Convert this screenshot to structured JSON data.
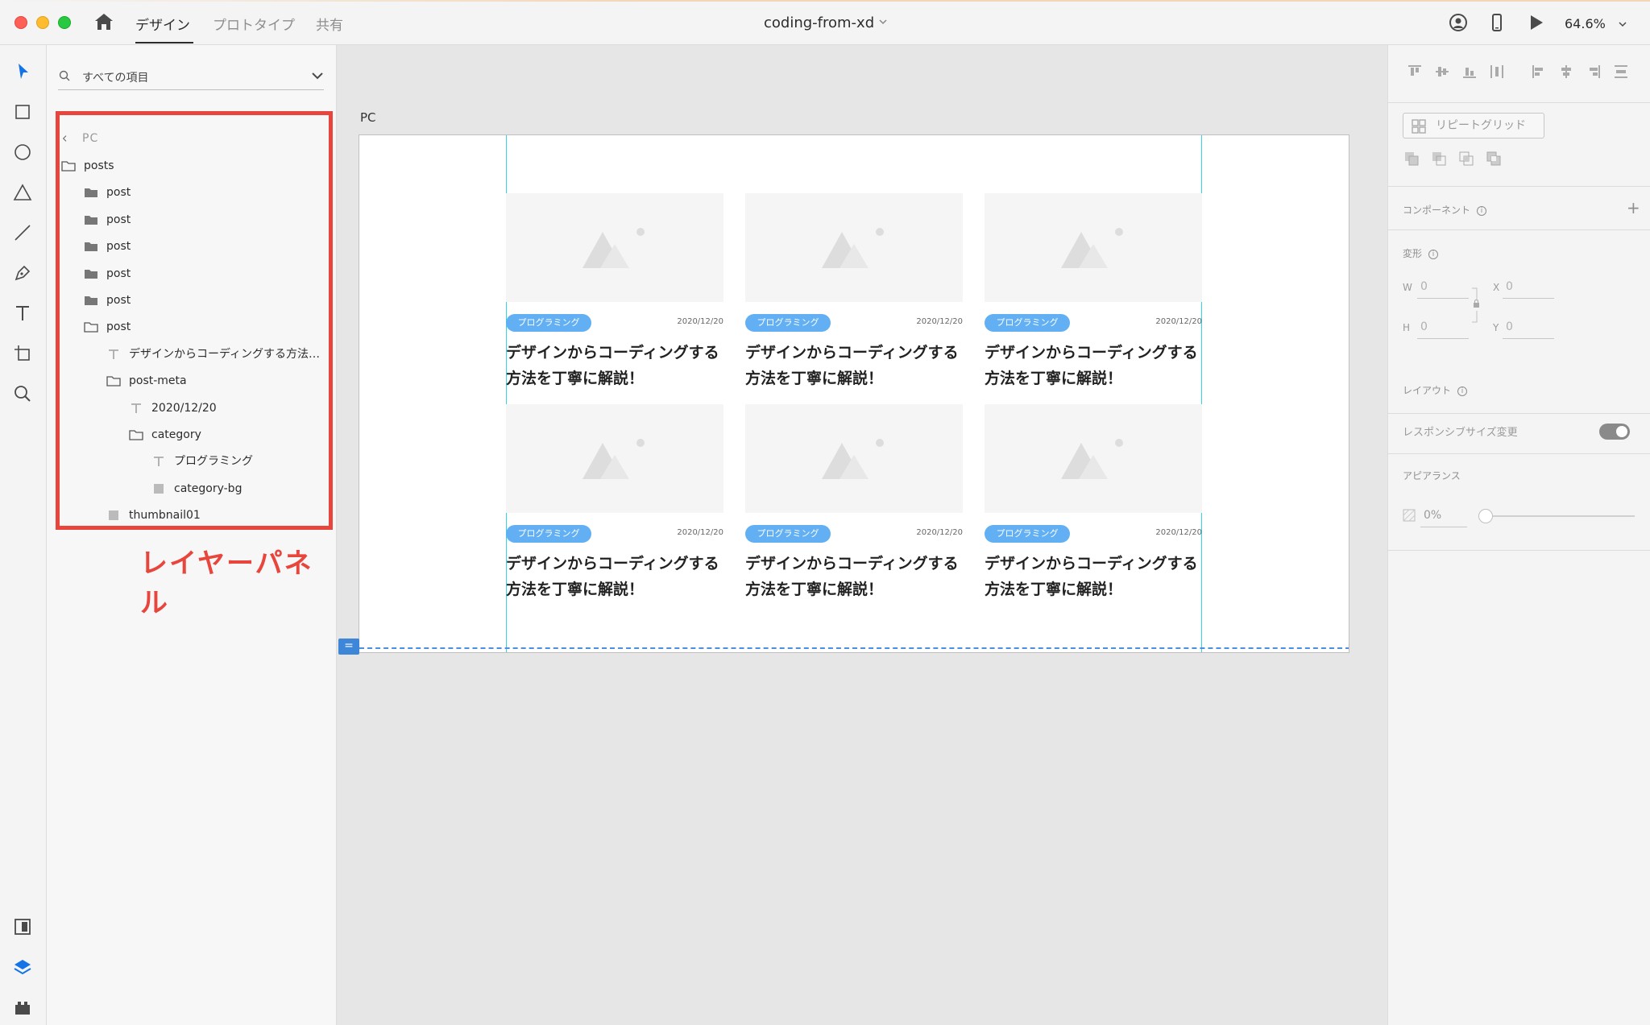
{
  "titlebar": {
    "tabs": [
      {
        "label": "デザイン",
        "active": true
      },
      {
        "label": "プロトタイプ",
        "active": false
      },
      {
        "label": "共有",
        "active": false
      }
    ],
    "document_title": "coding-from-xd",
    "zoom": "64.6%"
  },
  "layers": {
    "search_label": "すべての項目",
    "back_label": "PC",
    "items": [
      {
        "label": "posts",
        "icon": "folder-outline-icon",
        "depth": 0
      },
      {
        "label": "post",
        "icon": "folder-filled-icon",
        "depth": 1
      },
      {
        "label": "post",
        "icon": "folder-filled-icon",
        "depth": 1
      },
      {
        "label": "post",
        "icon": "folder-filled-icon",
        "depth": 1
      },
      {
        "label": "post",
        "icon": "folder-filled-icon",
        "depth": 1
      },
      {
        "label": "post",
        "icon": "folder-filled-icon",
        "depth": 1
      },
      {
        "label": "post",
        "icon": "folder-outline-icon",
        "depth": 1
      },
      {
        "label": "デザインからコーディングする方法…",
        "icon": "text-icon",
        "depth": 2
      },
      {
        "label": "post-meta",
        "icon": "folder-outline-icon",
        "depth": 2
      },
      {
        "label": "2020/12/20",
        "icon": "text-icon",
        "depth": 3
      },
      {
        "label": "category",
        "icon": "folder-outline-icon",
        "depth": 3
      },
      {
        "label": "プログラミング",
        "icon": "text-icon",
        "depth": 4
      },
      {
        "label": "category-bg",
        "icon": "rectangle-icon",
        "depth": 4
      },
      {
        "label": "thumbnail01",
        "icon": "rectangle-icon",
        "depth": 2
      }
    ],
    "callout": "レイヤーパネル"
  },
  "canvas": {
    "artboard_label": "PC",
    "cards": [
      {
        "category": "プログラミング",
        "date": "2020/12/20",
        "title": "デザインからコーディングする方法を丁寧に解説！"
      },
      {
        "category": "プログラミング",
        "date": "2020/12/20",
        "title": "デザインからコーディングする方法を丁寧に解説！"
      },
      {
        "category": "プログラミング",
        "date": "2020/12/20",
        "title": "デザインからコーディングする方法を丁寧に解説！"
      },
      {
        "category": "プログラミング",
        "date": "2020/12/20",
        "title": "デザインからコーディングする方法を丁寧に解説！"
      },
      {
        "category": "プログラミング",
        "date": "2020/12/20",
        "title": "デザインからコーディングする方法を丁寧に解説！"
      },
      {
        "category": "プログラミング",
        "date": "2020/12/20",
        "title": "デザインからコーディングする方法を丁寧に解説！"
      }
    ]
  },
  "props": {
    "repeat_grid": "リピートグリッド",
    "component": "コンポーネント",
    "transform": "変形",
    "w_label": "W",
    "w_value": "0",
    "x_label": "X",
    "x_value": "0",
    "h_label": "H",
    "h_value": "0",
    "y_label": "Y",
    "y_value": "0",
    "layout": "レイアウト",
    "responsive_resize": "レスポンシブサイズ変更",
    "appearance": "アピアランス",
    "opacity_value": "0%"
  },
  "colors": {
    "accent_blue": "#62b0f3",
    "highlight_red": "#e8453c",
    "guide_cyan": "#33d6e6"
  }
}
